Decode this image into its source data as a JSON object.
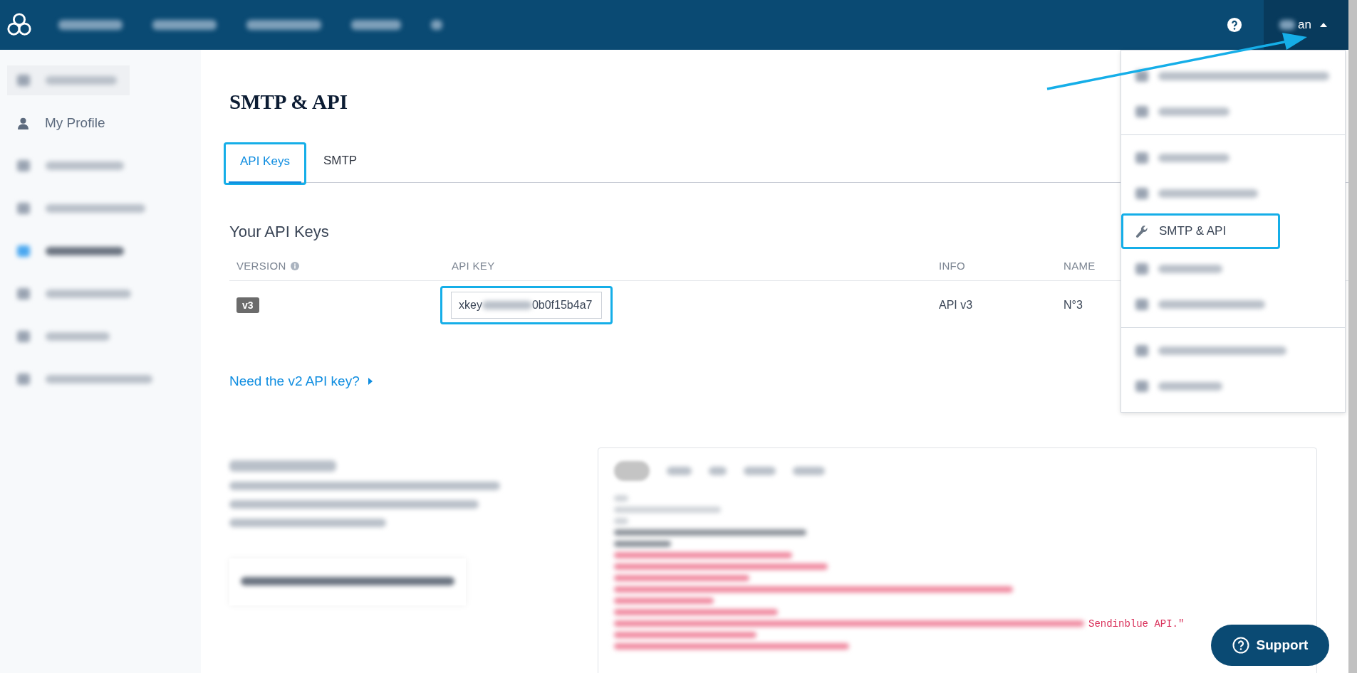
{
  "topbar": {
    "user_name": "an"
  },
  "sidebar": {
    "items": [
      {
        "kind": "redacted_header"
      },
      {
        "kind": "item",
        "label": "My Profile",
        "selected": false
      },
      {
        "kind": "redacted",
        "selected": false
      },
      {
        "kind": "redacted",
        "selected": false
      },
      {
        "kind": "redacted",
        "selected": true
      },
      {
        "kind": "redacted",
        "selected": false
      },
      {
        "kind": "redacted",
        "selected": false
      },
      {
        "kind": "redacted",
        "selected": false
      }
    ]
  },
  "page_title": "SMTP & API",
  "tabs": [
    {
      "label": "API Keys",
      "selected": true,
      "highlighted": true
    },
    {
      "label": "SMTP",
      "selected": false,
      "highlighted": false
    }
  ],
  "section_title": "Your API Keys",
  "table": {
    "columns": [
      "VERSION",
      "API KEY",
      "INFO",
      "NAME"
    ],
    "rows": [
      {
        "version": "v3",
        "api_key_start": "xkey",
        "api_key_end": "0b0f15b4a7",
        "key_highlighted": true,
        "info": "API v3",
        "name": "N°3"
      }
    ]
  },
  "v2_link": "Need the v2 API key?",
  "code_sample": {
    "tabs": [
      {
        "selected": true
      },
      {
        "selected": false
      },
      {
        "selected": false
      },
      {
        "selected": false
      },
      {
        "selected": false
      }
    ],
    "visible_fragment": "Sendinblue API.\""
  },
  "dropdown": {
    "items": [
      {
        "kind": "redacted"
      },
      {
        "kind": "redacted",
        "divider_after": true
      },
      {
        "kind": "redacted"
      },
      {
        "kind": "redacted"
      },
      {
        "kind": "item",
        "label": "SMTP & API",
        "highlighted": true
      },
      {
        "kind": "redacted"
      },
      {
        "kind": "redacted",
        "divider_after": true
      },
      {
        "kind": "redacted"
      },
      {
        "kind": "redacted"
      }
    ]
  },
  "support_button": "Support"
}
